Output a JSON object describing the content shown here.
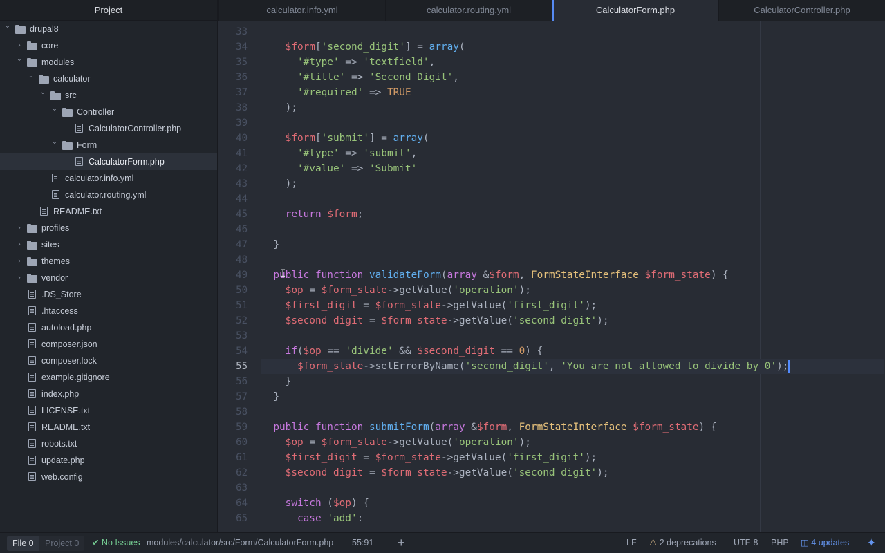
{
  "sidebar": {
    "title": "Project",
    "tree": [
      {
        "label": "drupal8",
        "type": "folder",
        "depth": 0,
        "expanded": true
      },
      {
        "label": "core",
        "type": "folder",
        "depth": 1,
        "expanded": false
      },
      {
        "label": "modules",
        "type": "folder",
        "depth": 1,
        "expanded": true
      },
      {
        "label": "calculator",
        "type": "folder",
        "depth": 2,
        "expanded": true
      },
      {
        "label": "src",
        "type": "folder",
        "depth": 3,
        "expanded": true
      },
      {
        "label": "Controller",
        "type": "folder",
        "depth": 4,
        "expanded": true
      },
      {
        "label": "CalculatorController.php",
        "type": "file",
        "depth": 5
      },
      {
        "label": "Form",
        "type": "folder",
        "depth": 4,
        "expanded": true
      },
      {
        "label": "CalculatorForm.php",
        "type": "file",
        "depth": 5,
        "selected": true
      },
      {
        "label": "calculator.info.yml",
        "type": "file",
        "depth": 3
      },
      {
        "label": "calculator.routing.yml",
        "type": "file",
        "depth": 3
      },
      {
        "label": "README.txt",
        "type": "file",
        "depth": 2
      },
      {
        "label": "profiles",
        "type": "folder",
        "depth": 1,
        "expanded": false
      },
      {
        "label": "sites",
        "type": "folder",
        "depth": 1,
        "expanded": false
      },
      {
        "label": "themes",
        "type": "folder",
        "depth": 1,
        "expanded": false
      },
      {
        "label": "vendor",
        "type": "folder",
        "depth": 1,
        "expanded": false
      },
      {
        "label": ".DS_Store",
        "type": "file",
        "depth": 1
      },
      {
        "label": ".htaccess",
        "type": "file",
        "depth": 1
      },
      {
        "label": "autoload.php",
        "type": "file",
        "depth": 1
      },
      {
        "label": "composer.json",
        "type": "file",
        "depth": 1
      },
      {
        "label": "composer.lock",
        "type": "file",
        "depth": 1
      },
      {
        "label": "example.gitignore",
        "type": "file",
        "depth": 1
      },
      {
        "label": "index.php",
        "type": "file",
        "depth": 1
      },
      {
        "label": "LICENSE.txt",
        "type": "file",
        "depth": 1
      },
      {
        "label": "README.txt",
        "type": "file",
        "depth": 1
      },
      {
        "label": "robots.txt",
        "type": "file",
        "depth": 1
      },
      {
        "label": "update.php",
        "type": "file",
        "depth": 1
      },
      {
        "label": "web.config",
        "type": "file",
        "depth": 1
      }
    ]
  },
  "tabs": [
    {
      "label": "calculator.info.yml",
      "active": false
    },
    {
      "label": "calculator.routing.yml",
      "active": false
    },
    {
      "label": "CalculatorForm.php",
      "active": true
    },
    {
      "label": "CalculatorController.php",
      "active": false
    }
  ],
  "editor": {
    "active_line": 55,
    "lines": [
      {
        "n": 33,
        "tokens": []
      },
      {
        "n": 34,
        "tokens": [
          [
            "p",
            "    "
          ],
          [
            "v",
            "$form"
          ],
          [
            "p",
            "["
          ],
          [
            "s",
            "'second_digit'"
          ],
          [
            "p",
            "] = "
          ],
          [
            "f",
            "array"
          ],
          [
            "p",
            "("
          ]
        ]
      },
      {
        "n": 35,
        "tokens": [
          [
            "p",
            "      "
          ],
          [
            "s",
            "'#type'"
          ],
          [
            "p",
            " => "
          ],
          [
            "s",
            "'textfield'"
          ],
          [
            "p",
            ","
          ]
        ]
      },
      {
        "n": 36,
        "tokens": [
          [
            "p",
            "      "
          ],
          [
            "s",
            "'#title'"
          ],
          [
            "p",
            " => "
          ],
          [
            "s",
            "'Second Digit'"
          ],
          [
            "p",
            ","
          ]
        ]
      },
      {
        "n": 37,
        "tokens": [
          [
            "p",
            "      "
          ],
          [
            "s",
            "'#required'"
          ],
          [
            "p",
            " => "
          ],
          [
            "n",
            "TRUE"
          ]
        ]
      },
      {
        "n": 38,
        "tokens": [
          [
            "p",
            "    );"
          ]
        ]
      },
      {
        "n": 39,
        "tokens": []
      },
      {
        "n": 40,
        "tokens": [
          [
            "p",
            "    "
          ],
          [
            "v",
            "$form"
          ],
          [
            "p",
            "["
          ],
          [
            "s",
            "'submit'"
          ],
          [
            "p",
            "] = "
          ],
          [
            "f",
            "array"
          ],
          [
            "p",
            "("
          ]
        ]
      },
      {
        "n": 41,
        "tokens": [
          [
            "p",
            "      "
          ],
          [
            "s",
            "'#type'"
          ],
          [
            "p",
            " => "
          ],
          [
            "s",
            "'submit'"
          ],
          [
            "p",
            ","
          ]
        ]
      },
      {
        "n": 42,
        "tokens": [
          [
            "p",
            "      "
          ],
          [
            "s",
            "'#value'"
          ],
          [
            "p",
            " => "
          ],
          [
            "s",
            "'Submit'"
          ]
        ]
      },
      {
        "n": 43,
        "tokens": [
          [
            "p",
            "    );"
          ]
        ]
      },
      {
        "n": 44,
        "tokens": []
      },
      {
        "n": 45,
        "tokens": [
          [
            "p",
            "    "
          ],
          [
            "k",
            "return"
          ],
          [
            "p",
            " "
          ],
          [
            "v",
            "$form"
          ],
          [
            "p",
            ";"
          ]
        ]
      },
      {
        "n": 46,
        "tokens": []
      },
      {
        "n": 47,
        "tokens": [
          [
            "p",
            "  }"
          ]
        ]
      },
      {
        "n": 48,
        "tokens": []
      },
      {
        "n": 49,
        "tokens": [
          [
            "p",
            "  "
          ],
          [
            "k",
            "public"
          ],
          [
            "p",
            " "
          ],
          [
            "k",
            "function"
          ],
          [
            "p",
            " "
          ],
          [
            "f",
            "validateForm"
          ],
          [
            "p",
            "("
          ],
          [
            "k",
            "array"
          ],
          [
            "p",
            " &"
          ],
          [
            "v",
            "$form"
          ],
          [
            "p",
            ", "
          ],
          [
            "c",
            "FormStateInterface"
          ],
          [
            "p",
            " "
          ],
          [
            "v",
            "$form_state"
          ],
          [
            "p",
            ") {"
          ]
        ]
      },
      {
        "n": 50,
        "tokens": [
          [
            "p",
            "    "
          ],
          [
            "v",
            "$op"
          ],
          [
            "p",
            " = "
          ],
          [
            "v",
            "$form_state"
          ],
          [
            "p",
            "->getValue("
          ],
          [
            "s",
            "'operation'"
          ],
          [
            "p",
            ");"
          ]
        ]
      },
      {
        "n": 51,
        "tokens": [
          [
            "p",
            "    "
          ],
          [
            "v",
            "$first_digit"
          ],
          [
            "p",
            " = "
          ],
          [
            "v",
            "$form_state"
          ],
          [
            "p",
            "->getValue("
          ],
          [
            "s",
            "'first_digit'"
          ],
          [
            "p",
            ");"
          ]
        ]
      },
      {
        "n": 52,
        "tokens": [
          [
            "p",
            "    "
          ],
          [
            "v",
            "$second_digit"
          ],
          [
            "p",
            " = "
          ],
          [
            "v",
            "$form_state"
          ],
          [
            "p",
            "->getValue("
          ],
          [
            "s",
            "'second_digit'"
          ],
          [
            "p",
            ");"
          ]
        ]
      },
      {
        "n": 53,
        "tokens": []
      },
      {
        "n": 54,
        "tokens": [
          [
            "p",
            "    "
          ],
          [
            "k",
            "if"
          ],
          [
            "p",
            "("
          ],
          [
            "v",
            "$op"
          ],
          [
            "p",
            " == "
          ],
          [
            "s",
            "'divide'"
          ],
          [
            "p",
            " && "
          ],
          [
            "v",
            "$second_digit"
          ],
          [
            "p",
            " == "
          ],
          [
            "n",
            "0"
          ],
          [
            "p",
            ") {"
          ]
        ]
      },
      {
        "n": 55,
        "tokens": [
          [
            "p",
            "      "
          ],
          [
            "v",
            "$form_state"
          ],
          [
            "p",
            "->setErrorByName("
          ],
          [
            "s",
            "'second_digit'"
          ],
          [
            "p",
            ", "
          ],
          [
            "s",
            "'You are not allowed to divide by 0'"
          ],
          [
            "p",
            ");"
          ]
        ]
      },
      {
        "n": 56,
        "tokens": [
          [
            "p",
            "    }"
          ]
        ]
      },
      {
        "n": 57,
        "tokens": [
          [
            "p",
            "  }"
          ]
        ]
      },
      {
        "n": 58,
        "tokens": []
      },
      {
        "n": 59,
        "tokens": [
          [
            "p",
            "  "
          ],
          [
            "k",
            "public"
          ],
          [
            "p",
            " "
          ],
          [
            "k",
            "function"
          ],
          [
            "p",
            " "
          ],
          [
            "f",
            "submitForm"
          ],
          [
            "p",
            "("
          ],
          [
            "k",
            "array"
          ],
          [
            "p",
            " &"
          ],
          [
            "v",
            "$form"
          ],
          [
            "p",
            ", "
          ],
          [
            "c",
            "FormStateInterface"
          ],
          [
            "p",
            " "
          ],
          [
            "v",
            "$form_state"
          ],
          [
            "p",
            ") {"
          ]
        ]
      },
      {
        "n": 60,
        "tokens": [
          [
            "p",
            "    "
          ],
          [
            "v",
            "$op"
          ],
          [
            "p",
            " = "
          ],
          [
            "v",
            "$form_state"
          ],
          [
            "p",
            "->getValue("
          ],
          [
            "s",
            "'operation'"
          ],
          [
            "p",
            ");"
          ]
        ]
      },
      {
        "n": 61,
        "tokens": [
          [
            "p",
            "    "
          ],
          [
            "v",
            "$first_digit"
          ],
          [
            "p",
            " = "
          ],
          [
            "v",
            "$form_state"
          ],
          [
            "p",
            "->getValue("
          ],
          [
            "s",
            "'first_digit'"
          ],
          [
            "p",
            ");"
          ]
        ]
      },
      {
        "n": 62,
        "tokens": [
          [
            "p",
            "    "
          ],
          [
            "v",
            "$second_digit"
          ],
          [
            "p",
            " = "
          ],
          [
            "v",
            "$form_state"
          ],
          [
            "p",
            "->getValue("
          ],
          [
            "s",
            "'second_digit'"
          ],
          [
            "p",
            ");"
          ]
        ]
      },
      {
        "n": 63,
        "tokens": []
      },
      {
        "n": 64,
        "tokens": [
          [
            "p",
            "    "
          ],
          [
            "k",
            "switch"
          ],
          [
            "p",
            " ("
          ],
          [
            "v",
            "$op"
          ],
          [
            "p",
            ") {"
          ]
        ]
      },
      {
        "n": 65,
        "tokens": [
          [
            "p",
            "      "
          ],
          [
            "k",
            "case"
          ],
          [
            "p",
            " "
          ],
          [
            "s",
            "'add'"
          ],
          [
            "p",
            ":"
          ]
        ]
      }
    ]
  },
  "statusbar": {
    "file_label": "File 0",
    "project_label": "Project 0",
    "no_issues": "No Issues",
    "path": "modules/calculator/src/Form/CalculatorForm.php",
    "cursor_position": "55:91",
    "add_symbol": "+",
    "line_ending": "LF",
    "deprecations": "2 deprecations",
    "encoding": "UTF-8",
    "grammar": "PHP",
    "updates": "4 updates"
  }
}
